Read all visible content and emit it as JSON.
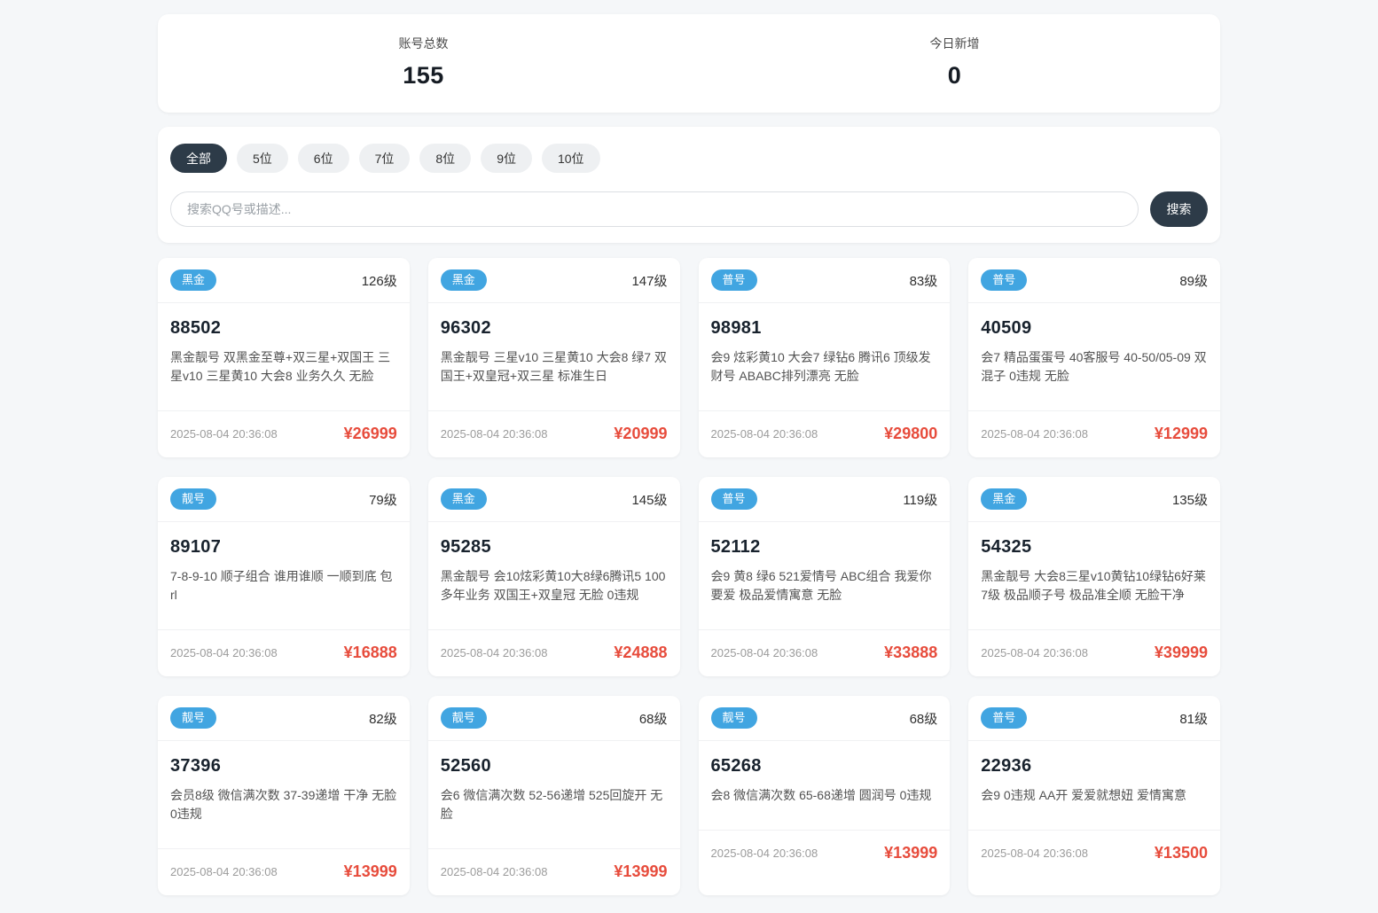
{
  "colors": {
    "page_bg": "#f5f7f9",
    "badge_blue": "#41a5e1",
    "accent_dark": "#2d3b48",
    "price_red": "#e74c3c"
  },
  "stats": {
    "items": [
      {
        "label": "账号总数",
        "value": "155"
      },
      {
        "label": "今日新增",
        "value": "0"
      }
    ]
  },
  "filters": {
    "tabs": [
      {
        "label": "全部",
        "active": true
      },
      {
        "label": "5位",
        "active": false
      },
      {
        "label": "6位",
        "active": false
      },
      {
        "label": "7位",
        "active": false
      },
      {
        "label": "8位",
        "active": false
      },
      {
        "label": "9位",
        "active": false
      },
      {
        "label": "10位",
        "active": false
      }
    ]
  },
  "search": {
    "placeholder": "搜索QQ号或描述...",
    "button_label": "搜索"
  },
  "cards": [
    {
      "badge": "黑金",
      "level": "126级",
      "number": "88502",
      "description": "黑金靓号 双黑金至尊+双三星+双国王 三星v10 三星黄10 大会8 业务久久 无脸",
      "date": "2025-08-04 20:36:08",
      "price": "¥26999"
    },
    {
      "badge": "黑金",
      "level": "147级",
      "number": "96302",
      "description": "黑金靓号 三星v10 三星黄10 大会8 绿7 双国王+双皇冠+双三星 标准生日",
      "date": "2025-08-04 20:36:08",
      "price": "¥20999"
    },
    {
      "badge": "普号",
      "level": "83级",
      "number": "98981",
      "description": "会9 炫彩黄10 大会7 绿钻6 腾讯6 顶级发财号 ABABC排列漂亮 无脸",
      "date": "2025-08-04 20:36:08",
      "price": "¥29800"
    },
    {
      "badge": "普号",
      "level": "89级",
      "number": "40509",
      "description": "会7 精品蛋蛋号 40客服号 40-50/05-09 双混子 0违规 无脸",
      "date": "2025-08-04 20:36:08",
      "price": "¥12999"
    },
    {
      "badge": "靓号",
      "level": "79级",
      "number": "89107",
      "description": "7-8-9-10 顺子组合 谁用谁顺 一顺到底 包rl",
      "date": "2025-08-04 20:36:08",
      "price": "¥16888"
    },
    {
      "badge": "黑金",
      "level": "145级",
      "number": "95285",
      "description": "黑金靓号 会10炫彩黄10大8绿6腾讯5 100多年业务 双国王+双皇冠 无脸 0违规",
      "date": "2025-08-04 20:36:08",
      "price": "¥24888"
    },
    {
      "badge": "普号",
      "level": "119级",
      "number": "52112",
      "description": "会9 黄8 绿6 521爱情号 ABC组合 我爱你要爱 极品爱情寓意 无脸",
      "date": "2025-08-04 20:36:08",
      "price": "¥33888"
    },
    {
      "badge": "黑金",
      "level": "135级",
      "number": "54325",
      "description": "黑金靓号 大会8三星v10黄钻10绿钻6好莱7级 极品顺子号 极品准全顺 无脸干净",
      "date": "2025-08-04 20:36:08",
      "price": "¥39999"
    },
    {
      "badge": "靓号",
      "level": "82级",
      "number": "37396",
      "description": "会员8级 微信满次数 37-39递增 干净 无脸 0违规",
      "date": "2025-08-04 20:36:08",
      "price": "¥13999"
    },
    {
      "badge": "靓号",
      "level": "68级",
      "number": "52560",
      "description": "会6 微信满次数 52-56递增 525回旋开 无脸",
      "date": "2025-08-04 20:36:08",
      "price": "¥13999"
    },
    {
      "badge": "靓号",
      "level": "68级",
      "number": "65268",
      "description": "会8 微信满次数 65-68递增 圆润号 0违规",
      "date": "2025-08-04 20:36:08",
      "price": "¥13999"
    },
    {
      "badge": "普号",
      "level": "81级",
      "number": "22936",
      "description": "会9 0违规 AA开 爱爱就想妞 爱情寓意",
      "date": "2025-08-04 20:36:08",
      "price": "¥13500"
    }
  ]
}
